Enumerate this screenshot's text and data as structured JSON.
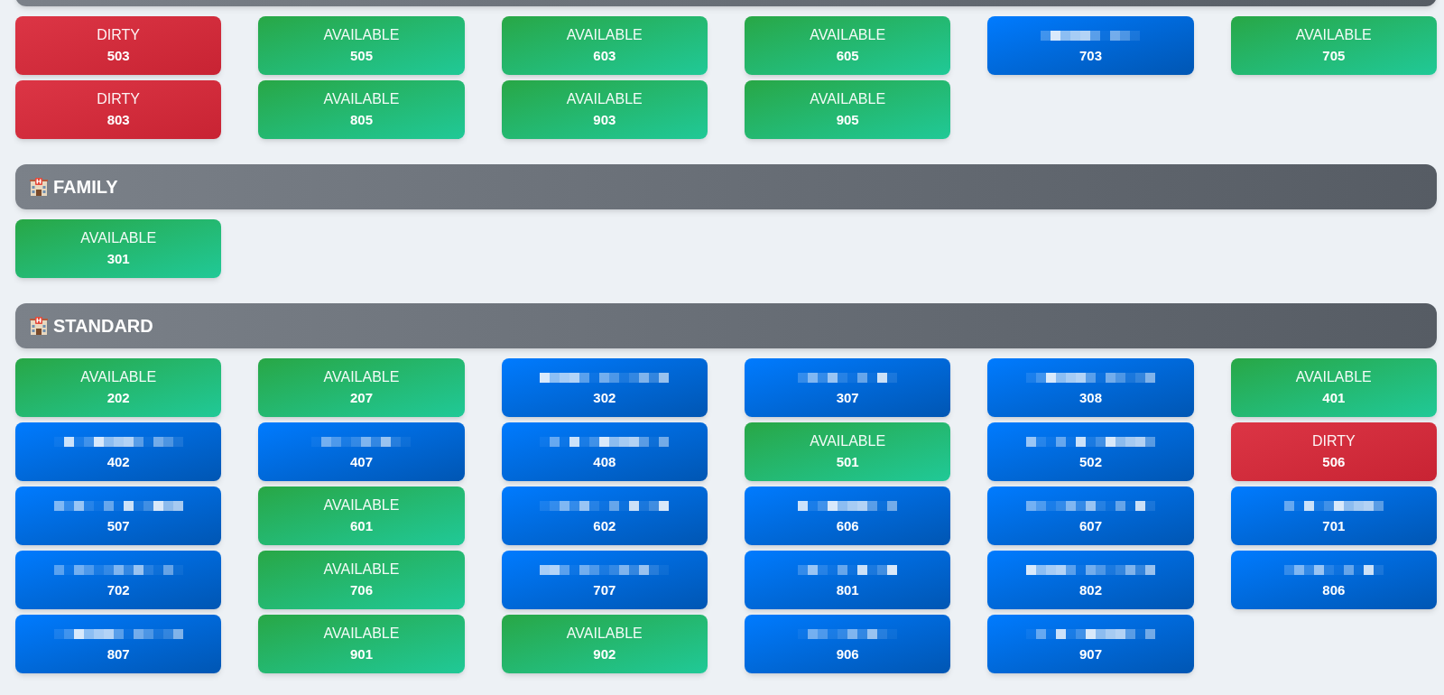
{
  "sections": [
    {
      "rooms": [
        {
          "kind": "dirty",
          "status": "DIRTY",
          "number": "503"
        },
        {
          "kind": "available",
          "status": "AVAILABLE",
          "number": "505"
        },
        {
          "kind": "available",
          "status": "AVAILABLE",
          "number": "603"
        },
        {
          "kind": "available",
          "status": "AVAILABLE",
          "number": "605"
        },
        {
          "kind": "occupied",
          "number": "703"
        },
        {
          "kind": "available",
          "status": "AVAILABLE",
          "number": "705"
        },
        {
          "kind": "dirty",
          "status": "DIRTY",
          "number": "803"
        },
        {
          "kind": "available",
          "status": "AVAILABLE",
          "number": "805"
        },
        {
          "kind": "available",
          "status": "AVAILABLE",
          "number": "903"
        },
        {
          "kind": "available",
          "status": "AVAILABLE",
          "number": "905"
        }
      ]
    },
    {
      "title": "FAMILY",
      "rooms": [
        {
          "kind": "available",
          "status": "AVAILABLE",
          "number": "301"
        }
      ]
    },
    {
      "title": "STANDARD",
      "rooms": [
        {
          "kind": "available",
          "status": "AVAILABLE",
          "number": "202"
        },
        {
          "kind": "available",
          "status": "AVAILABLE",
          "number": "207"
        },
        {
          "kind": "occupied",
          "number": "302"
        },
        {
          "kind": "occupied",
          "number": "307"
        },
        {
          "kind": "occupied",
          "number": "308"
        },
        {
          "kind": "available",
          "status": "AVAILABLE",
          "number": "401"
        },
        {
          "kind": "occupied",
          "number": "402"
        },
        {
          "kind": "occupied",
          "number": "407"
        },
        {
          "kind": "occupied",
          "number": "408"
        },
        {
          "kind": "available",
          "status": "AVAILABLE",
          "number": "501"
        },
        {
          "kind": "occupied",
          "number": "502"
        },
        {
          "kind": "dirty",
          "status": "DIRTY",
          "number": "506"
        },
        {
          "kind": "occupied",
          "number": "507"
        },
        {
          "kind": "available",
          "status": "AVAILABLE",
          "number": "601"
        },
        {
          "kind": "occupied",
          "number": "602"
        },
        {
          "kind": "occupied",
          "number": "606"
        },
        {
          "kind": "occupied",
          "number": "607"
        },
        {
          "kind": "occupied",
          "number": "701"
        },
        {
          "kind": "occupied",
          "number": "702"
        },
        {
          "kind": "available",
          "status": "AVAILABLE",
          "number": "706"
        },
        {
          "kind": "occupied",
          "number": "707"
        },
        {
          "kind": "occupied",
          "number": "801"
        },
        {
          "kind": "occupied",
          "number": "802"
        },
        {
          "kind": "occupied",
          "number": "806"
        },
        {
          "kind": "occupied",
          "number": "807"
        },
        {
          "kind": "available",
          "status": "AVAILABLE",
          "number": "901"
        },
        {
          "kind": "available",
          "status": "AVAILABLE",
          "number": "902"
        },
        {
          "kind": "occupied",
          "number": "906"
        },
        {
          "kind": "occupied",
          "number": "907"
        }
      ]
    }
  ]
}
